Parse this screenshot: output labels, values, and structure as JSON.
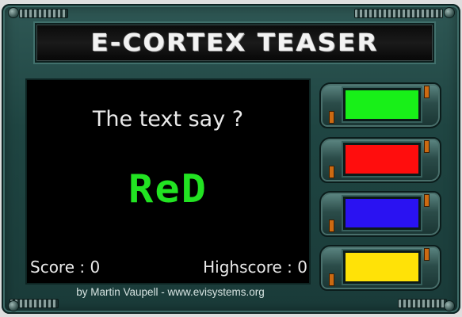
{
  "game": {
    "title": "E-CORTEX TEASER",
    "question": "The text say ?",
    "word": "ReD",
    "word_color": "#22e322",
    "score_label": "Score : 0",
    "highscore_label": "Highscore : 0",
    "credits": "by Martin Vaupell - www.evisystems.org"
  },
  "buttons": [
    {
      "color": "#18f018",
      "name": "green"
    },
    {
      "color": "#ff0d0d",
      "name": "red"
    },
    {
      "color": "#2a12f2",
      "name": "blue"
    },
    {
      "color": "#ffe207",
      "name": "yellow"
    }
  ],
  "colors": {
    "frame": "#1f4542",
    "screen": "#000000",
    "accent_orange": "#cc6a12"
  }
}
